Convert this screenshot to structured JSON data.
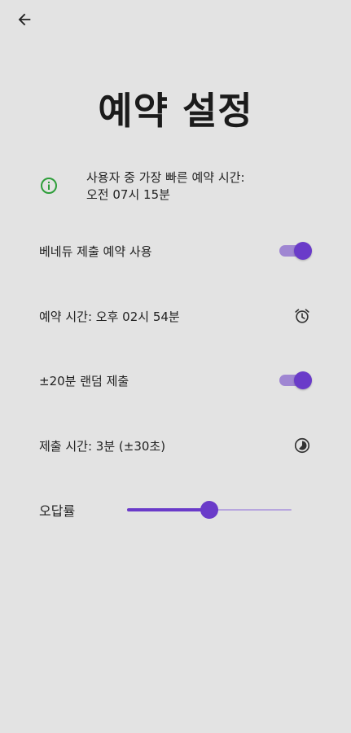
{
  "header": {
    "back_icon": "arrow-left-icon",
    "title": "예약 설정"
  },
  "info": {
    "icon": "info-icon",
    "icon_color": "#2e9e3a",
    "line1": "사용자 중 가장 빠른 예약 시간:",
    "line2": "오전 07시 15분"
  },
  "settings": {
    "submit_reservation_label": "베네듀 제출 예약 사용",
    "submit_reservation_enabled": true,
    "reservation_time_label": "예약 시간: 오후 02시 54분",
    "reservation_time_icon": "alarm-clock-icon",
    "random_submit_label": "±20분 랜덤 제출",
    "random_submit_enabled": true,
    "submit_duration_label": "제출 시간: 3분 (±30초)",
    "submit_duration_icon": "timelapse-icon",
    "error_rate_label": "오답률",
    "error_rate_fraction": 0.5
  },
  "colors": {
    "accent": "#6a3bc9",
    "accent_light": "#9f86d2",
    "background": "#e3e3e3"
  }
}
